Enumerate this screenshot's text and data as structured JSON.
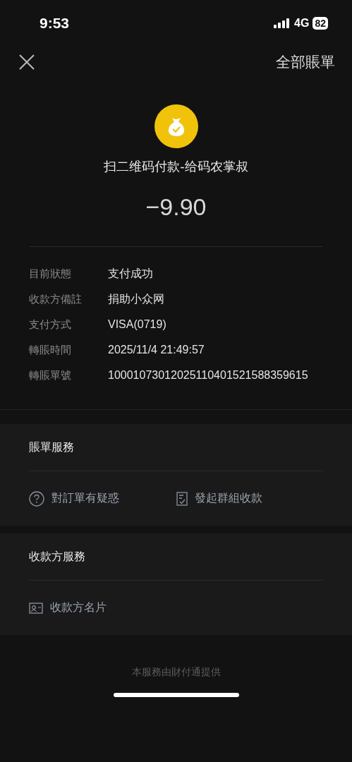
{
  "status_bar": {
    "time": "9:53",
    "network": "4G",
    "battery": "82"
  },
  "nav": {
    "title": "全部賬單"
  },
  "payment": {
    "title": "扫二维码付款-给码农掌叔",
    "amount": "−9.90"
  },
  "details": [
    {
      "label": "目前狀態",
      "value": "支付成功"
    },
    {
      "label": "收款方備註",
      "value": "捐助小众网"
    },
    {
      "label": "支付方式",
      "value": "VISA(0719)"
    },
    {
      "label": "轉賬時間",
      "value": "2025/11/4 21:49:57"
    },
    {
      "label": "轉賬單號",
      "value": "10001073012025110401521588359615"
    }
  ],
  "sections": [
    {
      "title": "賬單服務",
      "actions": [
        {
          "kind": "question",
          "label": "對訂單有疑惑"
        },
        {
          "kind": "receipt",
          "label": "發起群組收款"
        }
      ]
    },
    {
      "title": "收款方服務",
      "actions": [
        {
          "kind": "card",
          "label": "收款方名片"
        }
      ]
    }
  ],
  "footer": "本服務由財付通提供"
}
